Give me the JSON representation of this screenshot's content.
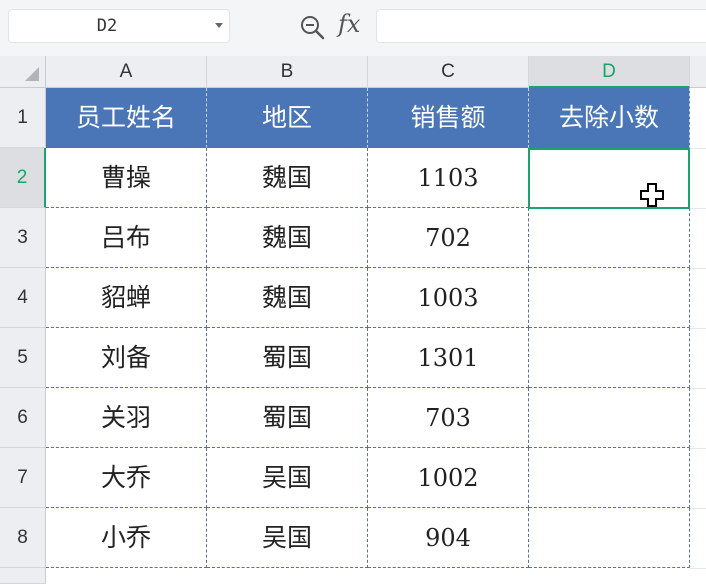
{
  "formula_bar": {
    "name_box": "D2",
    "fx_label": "fx",
    "formula": ""
  },
  "columns": [
    "A",
    "B",
    "C",
    "D"
  ],
  "active_column": "D",
  "rows": [
    "1",
    "2",
    "3",
    "4",
    "5",
    "6",
    "7",
    "8"
  ],
  "active_row": "2",
  "table": {
    "headers": [
      "员工姓名",
      "地区",
      "销售额",
      "去除小数"
    ],
    "data": [
      [
        "曹操",
        "魏国",
        "1103",
        ""
      ],
      [
        "吕布",
        "魏国",
        "702",
        ""
      ],
      [
        "貂蝉",
        "魏国",
        "1003",
        ""
      ],
      [
        "刘备",
        "蜀国",
        "1301",
        ""
      ],
      [
        "关羽",
        "蜀国",
        "703",
        ""
      ],
      [
        "大乔",
        "吴国",
        "1002",
        ""
      ],
      [
        "小乔",
        "吴国",
        "904",
        ""
      ]
    ]
  },
  "colors": {
    "header_fill": "#4a76b8",
    "selection": "#1aa36b"
  }
}
